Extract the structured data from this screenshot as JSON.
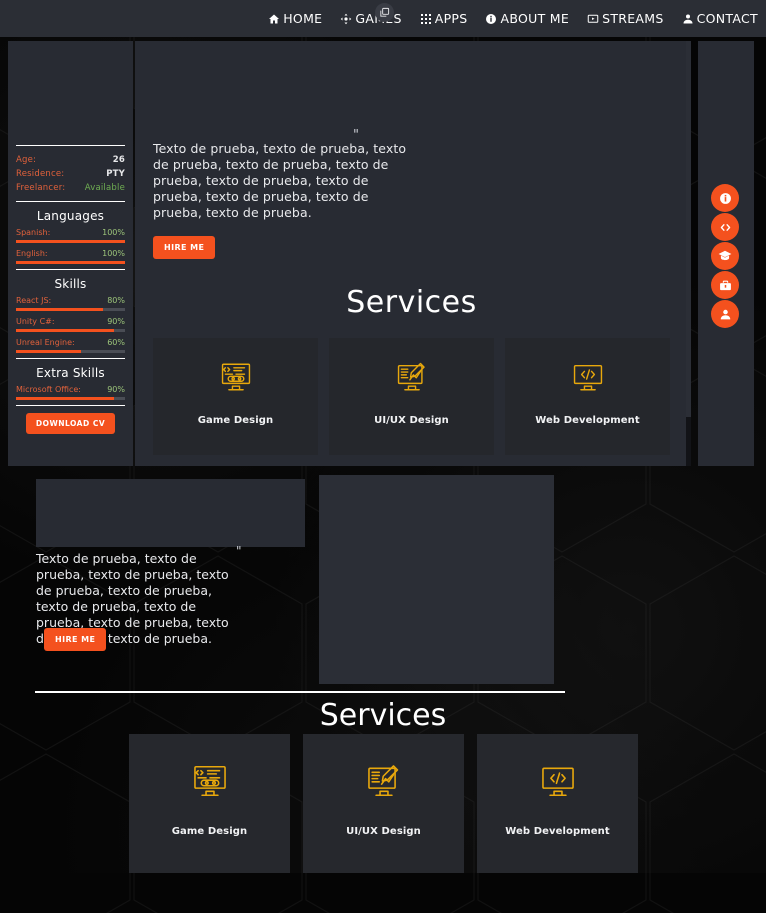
{
  "theme": {
    "accent": "#f4511e",
    "panel": "#282b33",
    "card": "#25272c",
    "navbar": "#2b2e35",
    "icon_gold": "#e8a80c",
    "available_green": "#6fae52",
    "percent_green": "#9cc47a",
    "key_orange": "#e0613b",
    "background": "#070707"
  },
  "navbar": {
    "badge_icon": "copy-windows-icon",
    "items": [
      {
        "label": "HOME",
        "icon": "home-icon"
      },
      {
        "label": "GAMES",
        "icon": "gamepad-icon"
      },
      {
        "label": "APPS",
        "icon": "grid-dots-icon"
      },
      {
        "label": "ABOUT ME",
        "icon": "info-circle-icon"
      },
      {
        "label": "STREAMS",
        "icon": "video-screen-icon"
      },
      {
        "label": "CONTACT",
        "icon": "person-icon"
      }
    ]
  },
  "sidebar": {
    "info": [
      {
        "key": "Age:",
        "value": "26",
        "style": "normal"
      },
      {
        "key": "Residence:",
        "value": "PTY",
        "style": "normal"
      },
      {
        "key": "Freelancer:",
        "value": "Available",
        "style": "green"
      }
    ],
    "languages": {
      "heading": "Languages",
      "items": [
        {
          "name": "Spanish:",
          "percent": "100%",
          "value": 100
        },
        {
          "name": "English:",
          "percent": "100%",
          "value": 100
        }
      ]
    },
    "skills": {
      "heading": "Skills",
      "items": [
        {
          "name": "React JS:",
          "percent": "80%",
          "value": 80
        },
        {
          "name": "Unity C#:",
          "percent": "90%",
          "value": 90
        },
        {
          "name": "Unreal Engine:",
          "percent": "60%",
          "value": 60
        }
      ]
    },
    "extra_skills": {
      "heading": "Extra Skills",
      "items": [
        {
          "name": "Microsoft Office:",
          "percent": "90%",
          "value": 90
        }
      ]
    },
    "download_cv_label": "DOWNLOAD CV"
  },
  "main": {
    "quote_mark": "\"",
    "hero_text": "Texto de prueba, texto de prueba, texto de prueba, texto de prueba, texto de prueba, texto de prueba, texto de prueba, texto de prueba, texto de prueba, texto de prueba.",
    "hire_label": "HIRE ME",
    "services_title": "Services",
    "services": [
      {
        "label": "Game Design",
        "icon": "monitor-gamepad-icon"
      },
      {
        "label": "UI/UX Design",
        "icon": "monitor-pencil-icon"
      },
      {
        "label": "Web Development",
        "icon": "monitor-code-icon"
      }
    ]
  },
  "rail": {
    "buttons": [
      {
        "icon": "info-circle-icon",
        "name": "about-me"
      },
      {
        "icon": "code-brackets-icon",
        "name": "skills"
      },
      {
        "icon": "graduation-cap-icon",
        "name": "education"
      },
      {
        "icon": "briefcase-icon",
        "name": "experience"
      },
      {
        "icon": "person-icon",
        "name": "contact"
      }
    ]
  },
  "lower": {
    "quote_mark": "\"",
    "hero_text": "Texto de prueba, texto de prueba, texto de prueba, texto de prueba, texto de prueba, texto de prueba, texto de prueba, texto de prueba, texto de prueba, texto de prueba.",
    "hire_label": "HIRE ME",
    "services_title": "Services",
    "services": [
      {
        "label": "Game Design",
        "icon": "monitor-gamepad-icon"
      },
      {
        "label": "UI/UX Design",
        "icon": "monitor-pencil-icon"
      },
      {
        "label": "Web Development",
        "icon": "monitor-code-icon"
      }
    ]
  }
}
